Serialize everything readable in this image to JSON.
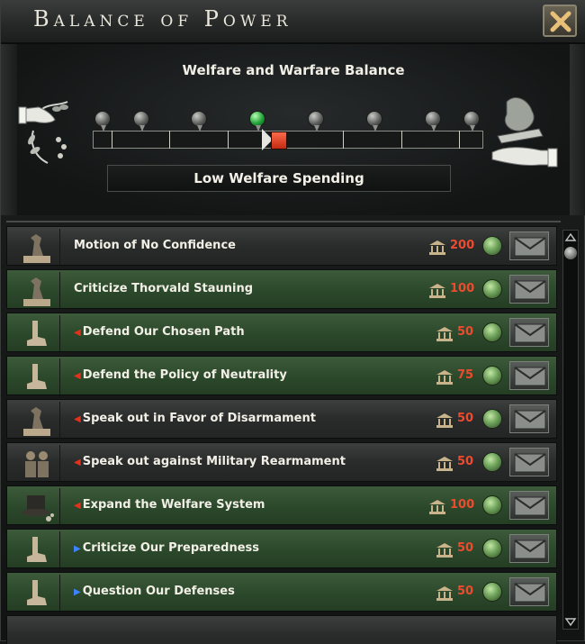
{
  "window": {
    "title": "Balance of Power"
  },
  "balance": {
    "title": "Welfare and Warfare Balance",
    "status": "Low Welfare Spending",
    "left_side": "welfare",
    "right_side": "warfare",
    "indicator_position": 0.44,
    "active_pin_index": 3
  },
  "decisions": [
    {
      "label": "Motion of No Confidence",
      "cost": "200",
      "style": "grey",
      "arrow": "none",
      "icon": "statue-icon"
    },
    {
      "label": "Criticize Thorvald Stauning",
      "cost": "100",
      "style": "green",
      "arrow": "none",
      "icon": "statue-icon"
    },
    {
      "label": "Defend Our Chosen Path",
      "cost": "50",
      "style": "green",
      "arrow": "left-red",
      "icon": "hand-icon"
    },
    {
      "label": "Defend the Policy of Neutrality",
      "cost": "75",
      "style": "green",
      "arrow": "left-red",
      "icon": "hand-icon"
    },
    {
      "label": "Speak out in Favor of Disarmament",
      "cost": "50",
      "style": "grey",
      "arrow": "left-red",
      "icon": "statue-icon"
    },
    {
      "label": "Speak out against Military Rearmament",
      "cost": "50",
      "style": "grey",
      "arrow": "left-red",
      "icon": "people-icon"
    },
    {
      "label": "Expand the Welfare System",
      "cost": "100",
      "style": "green",
      "arrow": "left-red",
      "icon": "hat-icon"
    },
    {
      "label": "Criticize Our Preparedness",
      "cost": "50",
      "style": "green",
      "arrow": "right-blue",
      "icon": "hand-icon"
    },
    {
      "label": "Question Our Defenses",
      "cost": "50",
      "style": "green",
      "arrow": "right-blue",
      "icon": "hand-icon"
    }
  ],
  "colors": {
    "cost_text": "#f04a2e",
    "green_row": "#2d4a2c",
    "grey_row": "#2a2c2c"
  }
}
